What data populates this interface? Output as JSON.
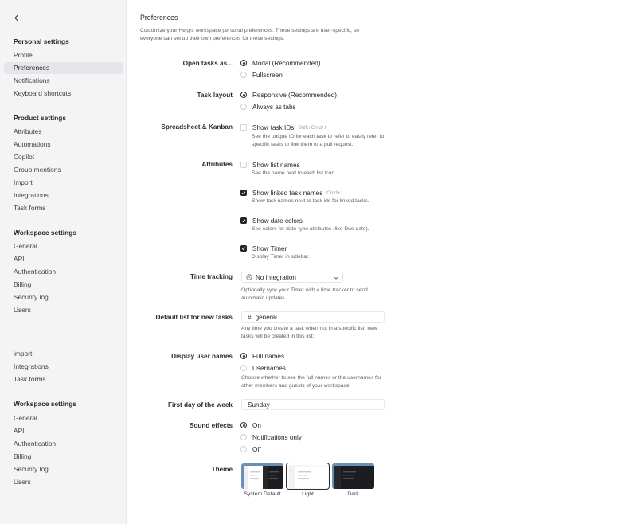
{
  "sidebar": {
    "personal_heading": "Personal settings",
    "personal_items": [
      "Profile",
      "Preferences",
      "Notifications",
      "Keyboard shortcuts"
    ],
    "product_heading": "Product settings",
    "product_items": [
      "Attributes",
      "Automations",
      "Copilot",
      "Group mentions",
      "Import",
      "Integrations",
      "Task forms"
    ],
    "workspace_heading": "Workspace settings",
    "workspace_items": [
      "General",
      "API",
      "Authentication",
      "Billing",
      "Security log",
      "Users"
    ],
    "extra_items": [
      "import",
      "Integrations",
      "Task forms"
    ],
    "workspace_heading_2": "Workspace settings",
    "workspace_items_2": [
      "General",
      "API",
      "Authentication",
      "Billing",
      "Security log",
      "Users"
    ],
    "active_item": "Preferences"
  },
  "page": {
    "title": "Preferences",
    "description": "Customize your Height workspace personal preferences. These settings are user-specific, so everyone can set up their own preferences for these settings."
  },
  "open_tasks": {
    "label": "Open tasks as...",
    "options": [
      "Modal (Recommended)",
      "Fullscreen"
    ],
    "selected": 0
  },
  "task_layout": {
    "label": "Task layout",
    "options": [
      "Responsive (Recommended)",
      "Always as tabs"
    ],
    "selected": 0
  },
  "spreadsheet": {
    "label": "Spreadsheet & Kanban",
    "option": "Show task IDs",
    "shortcut": "Shift+Cmd+I",
    "checked": false,
    "description": "See the unique ID for each task to refer to easily refer to specific tasks or link them to a pull request."
  },
  "attributes": {
    "label": "Attributes",
    "items": [
      {
        "option": "Show list names",
        "shortcut": "",
        "checked": false,
        "description": "See the name next to each list icon."
      },
      {
        "option": "Show linked task names",
        "shortcut": "Cmd+;",
        "checked": true,
        "description": "Show task names next to task ids for linked tasks."
      },
      {
        "option": "Show date colors",
        "shortcut": "",
        "checked": true,
        "description": "See colors for date-type attributes (like Due date)."
      },
      {
        "option": "Show Timer",
        "shortcut": "",
        "checked": true,
        "description": "Display Timer in sidebar."
      }
    ]
  },
  "time_tracking": {
    "label": "Time tracking",
    "value": "No integration",
    "description": "Optionally sync your Timer with a time tracker to send automatic updates."
  },
  "default_list": {
    "label": "Default list for new tasks",
    "value": "general",
    "description": "Any time you create a task when not in a specific list, new tasks will be created in this list:"
  },
  "display_names": {
    "label": "Display user names",
    "options": [
      "Full names",
      "Usernames"
    ],
    "selected": 0,
    "description": "Choose whether to see the full names or the usernames for other members and guests of your workspace."
  },
  "first_day": {
    "label": "First day of the week",
    "value": "Sunday"
  },
  "sound": {
    "label": "Sound effects",
    "options": [
      "On",
      "Notifications only",
      "Off"
    ],
    "selected": 0
  },
  "theme": {
    "label": "Theme",
    "options": [
      "System Default",
      "Light",
      "Dark"
    ],
    "selected": 1
  },
  "colors": {
    "sidebar_bg": "#f4f4f5",
    "active_item_bg": "#e5e6e9",
    "accent": "#22252a",
    "theme_blue": "#6b8fb5"
  }
}
